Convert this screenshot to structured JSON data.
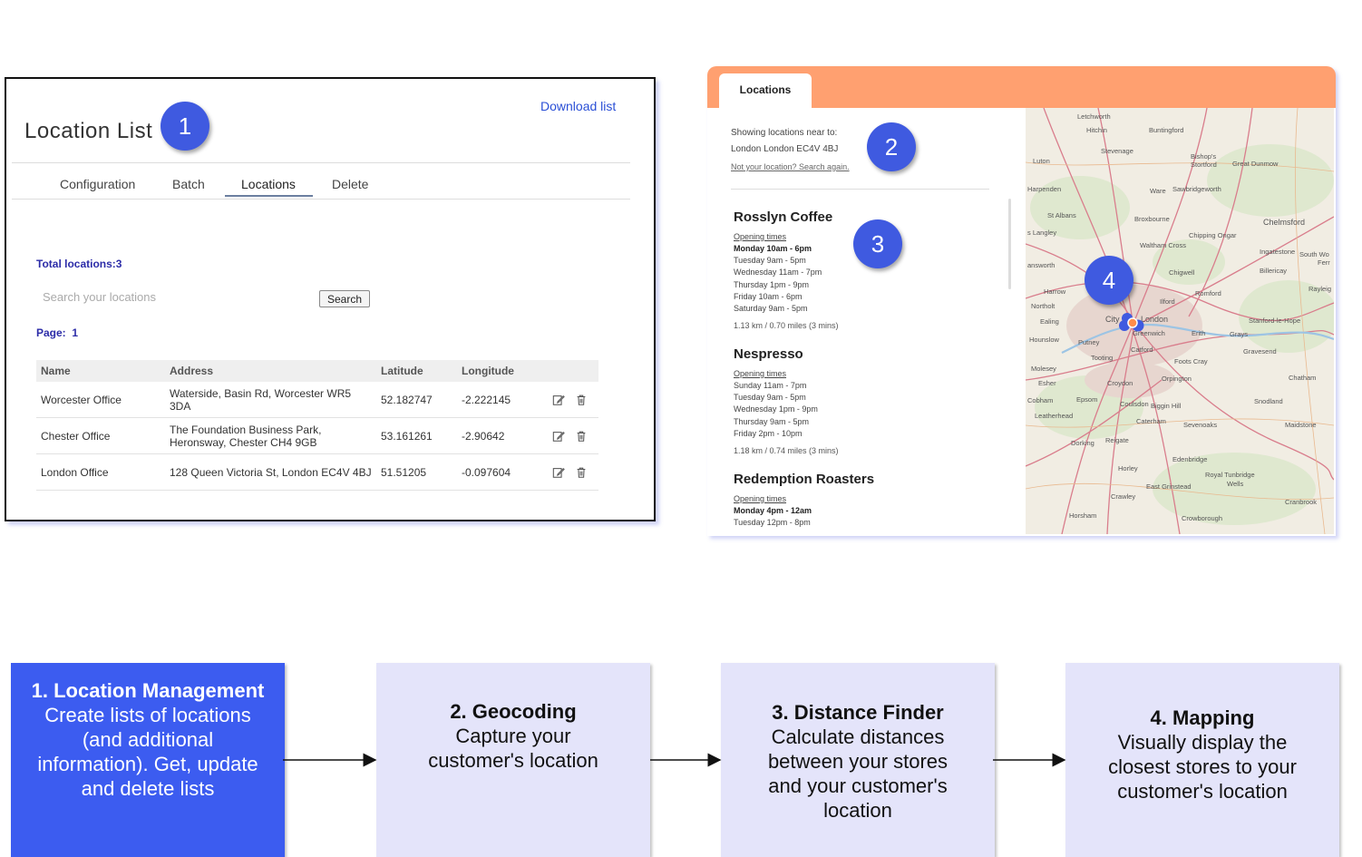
{
  "location_list": {
    "title": "Location List",
    "download_label": "Download list",
    "tabs": [
      "Configuration",
      "Batch",
      "Locations",
      "Delete"
    ],
    "active_tab": "Locations",
    "total_label": "Total locations:3",
    "search_placeholder": "Search your locations",
    "search_button": "Search",
    "page_label": "Page:",
    "page_value": "1",
    "columns": [
      "Name",
      "Address",
      "Latitude",
      "Longitude"
    ],
    "rows": [
      {
        "name": "Worcester Office",
        "address": "Waterside, Basin Rd, Worcester WR5 3DA",
        "latitude": "52.182747",
        "longitude": "-2.222145"
      },
      {
        "name": "Chester Office",
        "address": "The Foundation Business Park, Heronsway, Chester CH4 9GB",
        "latitude": "53.161261",
        "longitude": "-2.90642"
      },
      {
        "name": "London Office",
        "address": "128 Queen Victoria St, London EC4V 4BJ",
        "latitude": "51.51205",
        "longitude": "-0.097604"
      }
    ],
    "row_icons": [
      "edit-icon",
      "trash-icon"
    ]
  },
  "locator": {
    "tab_label": "Locations",
    "showing_label": "Showing locations near to:",
    "postcode": "London London EC4V 4BJ",
    "search_again": "Not your location? Search again.",
    "opening_label": "Opening times",
    "stores": [
      {
        "name": "Rosslyn Coffee",
        "hours": [
          "Monday 10am - 6pm",
          "Tuesday 9am - 5pm",
          "Wednesday 11am - 7pm",
          "Thursday 1pm - 9pm",
          "Friday 10am - 6pm",
          "Saturday 9am - 5pm"
        ],
        "distance": "1.13 km / 0.70 miles (3 mins)"
      },
      {
        "name": "Nespresso",
        "hours": [
          "Sunday 11am - 7pm",
          "Tuesday 9am - 5pm",
          "Wednesday 1pm - 9pm",
          "Thursday 9am - 5pm",
          "Friday 2pm - 10pm"
        ],
        "distance": "1.18 km / 0.74 miles (3 mins)"
      },
      {
        "name": "Redemption Roasters",
        "hours": [
          "Monday 4pm - 12am",
          "Tuesday 12pm - 8pm"
        ],
        "distance": ""
      }
    ],
    "map_places": [
      "Letchworth",
      "Hitchin",
      "Buntingford",
      "Stevenage",
      "Luton",
      "Bishop's Stortford",
      "Great Dunmow",
      "Harpenden",
      "Ware",
      "Sawbridgeworth",
      "St Albans",
      "Broxbourne",
      "Chelmsford",
      "Langley",
      "Waltham Cross",
      "Chipping Ongar",
      "Ingatestone",
      "South Woodham Ferrers",
      "Billericay",
      "Rickmansworth",
      "Chigwell",
      "Rayleigh",
      "Harrow",
      "Romford",
      "Ilford",
      "Northolt",
      "Ealing",
      "City of London",
      "Stanford-le-Hope",
      "Hounslow",
      "Putney",
      "Greenwich",
      "Erith",
      "Grays",
      "Catford",
      "Gravesend",
      "Tooting",
      "Foots Cray",
      "Molesey",
      "Esher",
      "Orpington",
      "Chatham",
      "Croydon",
      "Cobham",
      "Epsom",
      "Coulsdon",
      "Biggin Hill",
      "Snodland",
      "Leatherhead",
      "Caterham",
      "Sevenoaks",
      "Maidstone",
      "Dorking",
      "Reigate",
      "Edenbridge",
      "Horley",
      "East Grinstead",
      "Royal Tunbridge Wells",
      "Crawley",
      "Cranbrook",
      "Horsham",
      "Crowborough"
    ]
  },
  "badges": [
    "1",
    "2",
    "3",
    "4"
  ],
  "flow": [
    {
      "title": "1. Location Management",
      "body": [
        "Create lists of locations",
        "(and additional",
        "information). Get, update",
        "and delete lists"
      ]
    },
    {
      "title": "2. Geocoding",
      "body": [
        "Capture your",
        "customer's location"
      ]
    },
    {
      "title": "3. Distance Finder",
      "body": [
        "Calculate distances",
        "between your stores",
        "and your customer's",
        "location"
      ]
    },
    {
      "title": "4. Mapping",
      "body": [
        "Visually display the",
        "closest stores to your",
        "customer's location"
      ]
    }
  ],
  "colors": {
    "accent": "#3f5ae0",
    "widget_header": "#ffa070",
    "flow_active": "#3c5cf0",
    "flow_inactive": "#e4e4fa"
  }
}
